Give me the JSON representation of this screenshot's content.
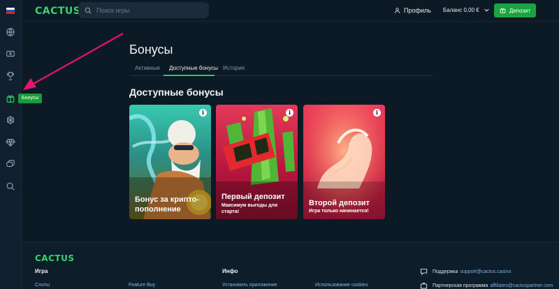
{
  "brand": "CACTUS",
  "search": {
    "placeholder": "Поиск игры"
  },
  "header": {
    "profile_label": "Профиль",
    "balance_label": "Баланс 0,00 €",
    "deposit_label": "Депозит"
  },
  "sidebar": {
    "items": [
      {
        "icon": "globe-icon"
      },
      {
        "icon": "ticket-icon"
      },
      {
        "icon": "trophy-icon"
      },
      {
        "icon": "gift-icon",
        "tooltip": "Бонусы"
      },
      {
        "icon": "tournament-icon"
      },
      {
        "icon": "diamond-icon"
      },
      {
        "icon": "chat-icon"
      },
      {
        "icon": "search-icon"
      }
    ]
  },
  "main": {
    "title": "Бонусы",
    "tabs": [
      {
        "label": "Активные"
      },
      {
        "label": "Доступные бонусы"
      },
      {
        "label": "История"
      }
    ],
    "active_tab": "Доступные бонусы",
    "section_title": "Доступные бонусы",
    "cards": [
      {
        "title_line1": "Бонус за крипто-",
        "title_line2": "пополнение",
        "subtitle_line1": "",
        "subtitle_line2": ""
      },
      {
        "title_line1": "Первый депозит",
        "title_line2": "",
        "subtitle_line1": "Максимум выгоды для",
        "subtitle_line2": "старта!"
      },
      {
        "title_line1": "Второй депозит",
        "title_line2": "",
        "subtitle_line1": "Игра только начинается!",
        "subtitle_line2": ""
      }
    ],
    "info_glyph": "i"
  },
  "footer": {
    "logo": "CACTUS",
    "col1_heading": "Игра",
    "col2_heading": "Инфо",
    "links": [
      "Слоты",
      "Feature Buy",
      "Установить приложение",
      "Использование cookies"
    ],
    "support_label": "Поддержка",
    "support_email": "support@cactus.casino",
    "partner_label": "Партнерская программа",
    "partner_email": "affiliates@cactuspartner.com"
  },
  "colors": {
    "accent": "#1aa33e",
    "brand_green": "#36d46a",
    "background": "#0c1a26",
    "arrow": "#e6146f"
  }
}
